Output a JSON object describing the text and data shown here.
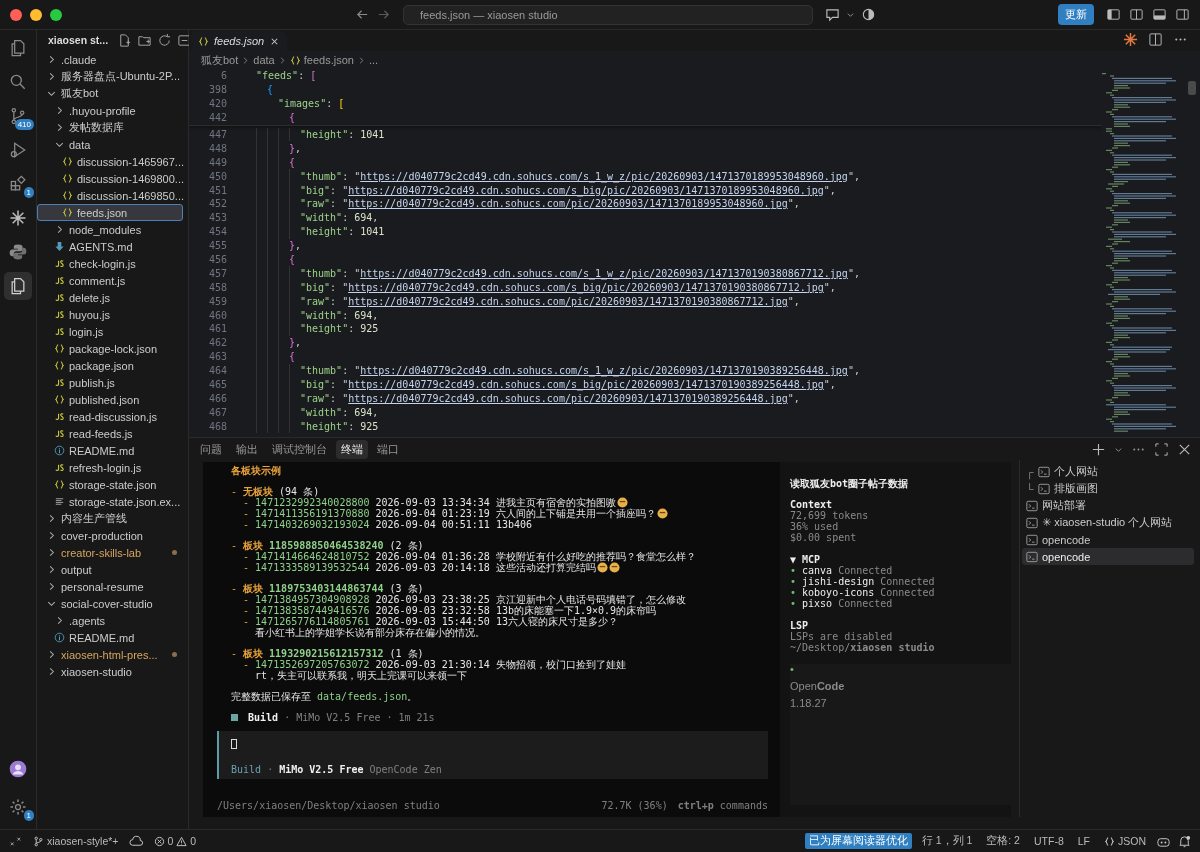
{
  "title_bar": {
    "title": "feeds.json — xiaosen studio",
    "update_button": "更新"
  },
  "activity_bar": {
    "items": [
      {
        "kind": "files",
        "selected": false
      },
      {
        "kind": "search",
        "selected": false
      },
      {
        "kind": "source-control",
        "selected": false,
        "badge": "410"
      },
      {
        "kind": "run",
        "selected": false
      },
      {
        "kind": "extensions",
        "selected": false,
        "badge": "1"
      },
      {
        "kind": "sparkle",
        "selected": false
      },
      {
        "kind": "python",
        "selected": false
      },
      {
        "kind": "docs",
        "selected": true
      }
    ],
    "settings_badge": "1"
  },
  "explorer": {
    "title": "xiaosen st...",
    "tree": [
      {
        "kind": "folder",
        "name": ".claude",
        "expanded": false,
        "selected": false,
        "modified": false
      },
      {
        "kind": "folder",
        "name": "服务器盘点-Ubuntu-2P...",
        "expanded": false,
        "selected": false,
        "modified": false
      },
      {
        "kind": "folder",
        "name": "狐友bot",
        "expanded": true,
        "selected": false,
        "modified": false,
        "children": [
          {
            "kind": "folder",
            "name": ".huyou-profile",
            "expanded": false,
            "selected": false
          },
          {
            "kind": "folder",
            "name": "发帖数据库",
            "expanded": false,
            "selected": false
          },
          {
            "kind": "folder",
            "name": "data",
            "expanded": true,
            "selected": false,
            "children": [
              {
                "kind": "json",
                "name": "discussion-1465967...",
                "selected": false
              },
              {
                "kind": "json",
                "name": "discussion-1469800...",
                "selected": false
              },
              {
                "kind": "json",
                "name": "discussion-1469850...",
                "selected": false
              },
              {
                "kind": "json",
                "name": "feeds.json",
                "selected": true
              }
            ]
          },
          {
            "kind": "folder",
            "name": "node_modules",
            "expanded": false,
            "selected": false
          },
          {
            "kind": "md",
            "name": "AGENTS.md",
            "selected": false
          },
          {
            "kind": "js",
            "name": "check-login.js",
            "selected": false
          },
          {
            "kind": "js",
            "name": "comment.js",
            "selected": false
          },
          {
            "kind": "js",
            "name": "delete.js",
            "selected": false
          },
          {
            "kind": "js",
            "name": "huyou.js",
            "selected": false
          },
          {
            "kind": "js",
            "name": "login.js",
            "selected": false
          },
          {
            "kind": "json",
            "name": "package-lock.json",
            "selected": false
          },
          {
            "kind": "json",
            "name": "package.json",
            "selected": false
          },
          {
            "kind": "js",
            "name": "publish.js",
            "selected": false
          },
          {
            "kind": "json",
            "name": "published.json",
            "selected": false
          },
          {
            "kind": "js",
            "name": "read-discussion.js",
            "selected": false
          },
          {
            "kind": "js",
            "name": "read-feeds.js",
            "selected": false
          },
          {
            "kind": "info",
            "name": "README.md",
            "selected": false
          },
          {
            "kind": "js",
            "name": "refresh-login.js",
            "selected": false
          },
          {
            "kind": "json",
            "name": "storage-state.json",
            "selected": false
          },
          {
            "kind": "text",
            "name": "storage-state.json.ex...",
            "selected": false
          }
        ]
      },
      {
        "kind": "folder",
        "name": "内容生产管线",
        "expanded": false,
        "selected": false,
        "modified": false
      },
      {
        "kind": "folder",
        "name": "cover-production",
        "expanded": false,
        "selected": false,
        "modified": false
      },
      {
        "kind": "folder",
        "name": "creator-skills-lab",
        "expanded": false,
        "selected": false,
        "modified": true
      },
      {
        "kind": "folder",
        "name": "output",
        "expanded": false,
        "selected": false,
        "modified": false
      },
      {
        "kind": "folder",
        "name": "personal-resume",
        "expanded": false,
        "selected": false,
        "modified": false
      },
      {
        "kind": "folder",
        "name": "social-cover-studio",
        "expanded": true,
        "selected": false,
        "modified": false,
        "children": [
          {
            "kind": "folder",
            "name": ".agents",
            "expanded": false,
            "selected": false
          },
          {
            "kind": "info",
            "name": "README.md",
            "selected": false
          }
        ]
      },
      {
        "kind": "folder",
        "name": "xiaosen-html-pres...",
        "expanded": false,
        "selected": false,
        "modified": true
      },
      {
        "kind": "folder",
        "name": "xiaosen-studio",
        "expanded": false,
        "selected": false,
        "modified": false
      }
    ]
  },
  "tabs": [
    {
      "label": "feeds.json",
      "selected": true
    }
  ],
  "breadcrumb": [
    {
      "kind": "folder",
      "text": "狐友bot"
    },
    {
      "kind": "folder",
      "text": "data"
    },
    {
      "kind": "json",
      "text": "feeds.json"
    },
    {
      "kind": "more",
      "text": "..."
    }
  ],
  "editor": {
    "sticky": [
      {
        "number": "6",
        "tokens": [
          {
            "kind": "key",
            "text": "\"feeds\""
          },
          {
            "kind": "punct",
            "text": ": "
          },
          {
            "kind": "open",
            "text": "["
          }
        ]
      },
      {
        "number": "398",
        "tokens": [
          {
            "kind": "open",
            "text": "{"
          }
        ]
      },
      {
        "number": "420",
        "tokens": [
          {
            "kind": "key",
            "text": "\"images\""
          },
          {
            "kind": "punct",
            "text": ": "
          },
          {
            "kind": "open",
            "text": "["
          }
        ]
      },
      {
        "number": "442",
        "tokens": [
          {
            "kind": "open",
            "text": "{"
          }
        ]
      }
    ],
    "lines": [
      {
        "number": "447",
        "tokens": [
          {
            "kind": "key",
            "text": "\"height\""
          },
          {
            "kind": "punct",
            "text": ": "
          },
          {
            "kind": "num",
            "text": "1041"
          }
        ]
      },
      {
        "number": "448",
        "tokens": [
          {
            "kind": "close",
            "text": "}"
          },
          {
            "kind": "punct",
            "text": ","
          }
        ]
      },
      {
        "number": "449",
        "tokens": [
          {
            "kind": "open",
            "text": "{"
          }
        ]
      },
      {
        "number": "450",
        "tokens": [
          {
            "kind": "key",
            "text": "\"thumb\""
          },
          {
            "kind": "punct",
            "text": ": \""
          },
          {
            "kind": "url",
            "text": "https://d040779c2cd49.cdn.sohucs.com/s_1_w_z/pic/20260903/1471370189953048960.jpg"
          },
          {
            "kind": "punct",
            "text": "\","
          }
        ]
      },
      {
        "number": "451",
        "tokens": [
          {
            "kind": "key",
            "text": "\"big\""
          },
          {
            "kind": "punct",
            "text": ": \""
          },
          {
            "kind": "url",
            "text": "https://d040779c2cd49.cdn.sohucs.com/s_big/pic/20260903/1471370189953048960.jpg"
          },
          {
            "kind": "punct",
            "text": "\","
          }
        ]
      },
      {
        "number": "452",
        "tokens": [
          {
            "kind": "key",
            "text": "\"raw\""
          },
          {
            "kind": "punct",
            "text": ": \""
          },
          {
            "kind": "url",
            "text": "https://d040779c2cd49.cdn.sohucs.com/pic/20260903/1471370189953048960.jpg"
          },
          {
            "kind": "punct",
            "text": "\","
          }
        ]
      },
      {
        "number": "453",
        "tokens": [
          {
            "kind": "key",
            "text": "\"width\""
          },
          {
            "kind": "punct",
            "text": ": "
          },
          {
            "kind": "num",
            "text": "694"
          },
          {
            "kind": "punct",
            "text": ","
          }
        ]
      },
      {
        "number": "454",
        "tokens": [
          {
            "kind": "key",
            "text": "\"height\""
          },
          {
            "kind": "punct",
            "text": ": "
          },
          {
            "kind": "num",
            "text": "1041"
          }
        ]
      },
      {
        "number": "455",
        "tokens": [
          {
            "kind": "close",
            "text": "}"
          },
          {
            "kind": "punct",
            "text": ","
          }
        ]
      },
      {
        "number": "456",
        "tokens": [
          {
            "kind": "open",
            "text": "{"
          }
        ]
      },
      {
        "number": "457",
        "tokens": [
          {
            "kind": "key",
            "text": "\"thumb\""
          },
          {
            "kind": "punct",
            "text": ": \""
          },
          {
            "kind": "url",
            "text": "https://d040779c2cd49.cdn.sohucs.com/s_1_w_z/pic/20260903/1471370190380867712.jpg"
          },
          {
            "kind": "punct",
            "text": "\","
          }
        ]
      },
      {
        "number": "458",
        "tokens": [
          {
            "kind": "key",
            "text": "\"big\""
          },
          {
            "kind": "punct",
            "text": ": \""
          },
          {
            "kind": "url",
            "text": "https://d040779c2cd49.cdn.sohucs.com/s_big/pic/20260903/1471370190380867712.jpg"
          },
          {
            "kind": "punct",
            "text": "\","
          }
        ]
      },
      {
        "number": "459",
        "tokens": [
          {
            "kind": "key",
            "text": "\"raw\""
          },
          {
            "kind": "punct",
            "text": ": \""
          },
          {
            "kind": "url",
            "text": "https://d040779c2cd49.cdn.sohucs.com/pic/20260903/1471370190380867712.jpg"
          },
          {
            "kind": "punct",
            "text": "\","
          }
        ]
      },
      {
        "number": "460",
        "tokens": [
          {
            "kind": "key",
            "text": "\"width\""
          },
          {
            "kind": "punct",
            "text": ": "
          },
          {
            "kind": "num",
            "text": "694"
          },
          {
            "kind": "punct",
            "text": ","
          }
        ]
      },
      {
        "number": "461",
        "tokens": [
          {
            "kind": "key",
            "text": "\"height\""
          },
          {
            "kind": "punct",
            "text": ": "
          },
          {
            "kind": "num",
            "text": "925"
          }
        ]
      },
      {
        "number": "462",
        "tokens": [
          {
            "kind": "close",
            "text": "}"
          },
          {
            "kind": "punct",
            "text": ","
          }
        ]
      },
      {
        "number": "463",
        "tokens": [
          {
            "kind": "open",
            "text": "{"
          }
        ]
      },
      {
        "number": "464",
        "tokens": [
          {
            "kind": "key",
            "text": "\"thumb\""
          },
          {
            "kind": "punct",
            "text": ": \""
          },
          {
            "kind": "url",
            "text": "https://d040779c2cd49.cdn.sohucs.com/s_1_w_z/pic/20260903/1471370190389256448.jpg"
          },
          {
            "kind": "punct",
            "text": "\","
          }
        ]
      },
      {
        "number": "465",
        "tokens": [
          {
            "kind": "key",
            "text": "\"big\""
          },
          {
            "kind": "punct",
            "text": ": \""
          },
          {
            "kind": "url",
            "text": "https://d040779c2cd49.cdn.sohucs.com/s_big/pic/20260903/1471370190389256448.jpg"
          },
          {
            "kind": "punct",
            "text": "\","
          }
        ]
      },
      {
        "number": "466",
        "tokens": [
          {
            "kind": "key",
            "text": "\"raw\""
          },
          {
            "kind": "punct",
            "text": ": \""
          },
          {
            "kind": "url",
            "text": "https://d040779c2cd49.cdn.sohucs.com/pic/20260903/1471370190389256448.jpg"
          },
          {
            "kind": "punct",
            "text": "\","
          }
        ]
      },
      {
        "number": "467",
        "tokens": [
          {
            "kind": "key",
            "text": "\"width\""
          },
          {
            "kind": "punct",
            "text": ": "
          },
          {
            "kind": "num",
            "text": "694"
          },
          {
            "kind": "punct",
            "text": ","
          }
        ]
      },
      {
        "number": "468",
        "tokens": [
          {
            "kind": "key",
            "text": "\"height\""
          },
          {
            "kind": "punct",
            "text": ": "
          },
          {
            "kind": "num",
            "text": "925"
          }
        ]
      }
    ]
  },
  "panel": {
    "tabs": [
      {
        "label": "问题",
        "selected": false
      },
      {
        "label": "输出",
        "selected": false
      },
      {
        "label": "调试控制台",
        "selected": false
      },
      {
        "label": "终端",
        "selected": true
      },
      {
        "label": "端口",
        "selected": false
      }
    ]
  },
  "terminal": {
    "blocks": [
      [
        [
          {
            "kind": "heading",
            "text": "各板块示例"
          }
        ]
      ],
      [
        [
          {
            "kind": "dash",
            "text": "- "
          },
          {
            "kind": "section",
            "text": "无板块"
          },
          {
            "kind": "text",
            "text": " (94 条)"
          }
        ],
        [
          {
            "kind": "dash",
            "text": "  - "
          },
          {
            "kind": "id",
            "text": "1471232992340028800"
          },
          {
            "kind": "text",
            "text": " 2026-09-03 13:34:34 进我主页有宿舍的实拍图嗷"
          },
          {
            "kind": "emoji"
          }
        ],
        [
          {
            "kind": "dash",
            "text": "  - "
          },
          {
            "kind": "id",
            "text": "1471411356191370880"
          },
          {
            "kind": "text",
            "text": " 2026-09-04 01:23:19 六人间的上下铺是共用一个插座吗？"
          },
          {
            "kind": "emoji"
          }
        ],
        [
          {
            "kind": "dash",
            "text": "  - "
          },
          {
            "kind": "id",
            "text": "1471403269032193024"
          },
          {
            "kind": "text",
            "text": " 2026-09-04 00:51:11 13b406"
          }
        ]
      ],
      [
        [
          {
            "kind": "dash",
            "text": "- "
          },
          {
            "kind": "section",
            "text": "板块 "
          },
          {
            "kind": "sid",
            "text": "1185988850464538240"
          },
          {
            "kind": "text",
            "text": " (2 条)"
          }
        ],
        [
          {
            "kind": "dash",
            "text": "  - "
          },
          {
            "kind": "id",
            "text": "1471414664624810752"
          },
          {
            "kind": "text",
            "text": " 2026-09-04 01:36:28 学校附近有什么好吃的推荐吗？食堂怎么样？"
          }
        ],
        [
          {
            "kind": "dash",
            "text": "  - "
          },
          {
            "kind": "id",
            "text": "1471333589139532544"
          },
          {
            "kind": "text",
            "text": " 2026-09-03 20:14:18 这些活动还打算完结吗"
          },
          {
            "kind": "emoji"
          },
          {
            "kind": "emoji"
          }
        ]
      ],
      [
        [
          {
            "kind": "dash",
            "text": "- "
          },
          {
            "kind": "section",
            "text": "板块 "
          },
          {
            "kind": "sid",
            "text": "1189753403144863744"
          },
          {
            "kind": "text",
            "text": " (3 条)"
          }
        ],
        [
          {
            "kind": "dash",
            "text": "  - "
          },
          {
            "kind": "id",
            "text": "1471384957304908928"
          },
          {
            "kind": "text",
            "text": " 2026-09-03 23:38:25 京江迎新中个人电话号码填错了，怎么修改"
          }
        ],
        [
          {
            "kind": "dash",
            "text": "  - "
          },
          {
            "kind": "id",
            "text": "1471383587449416576"
          },
          {
            "kind": "text",
            "text": " 2026-09-03 23:32:58 13b的床能塞一下1.9×0.9的床帘吗"
          }
        ],
        [
          {
            "kind": "dash",
            "text": "  - "
          },
          {
            "kind": "id",
            "text": "1471265776114805761"
          },
          {
            "kind": "text",
            "text": " 2026-09-03 15:44:50 13六人寝的床尺寸是多少？"
          }
        ],
        [
          {
            "kind": "text",
            "text": "    看小红书上的学姐学长说有部分床存在偏小的情况。"
          }
        ]
      ],
      [
        [
          {
            "kind": "dash",
            "text": "- "
          },
          {
            "kind": "section",
            "text": "板块 "
          },
          {
            "kind": "sid",
            "text": "1193290215612157312"
          },
          {
            "kind": "text",
            "text": " (1 条)"
          }
        ],
        [
          {
            "kind": "dash",
            "text": "  - "
          },
          {
            "kind": "id",
            "text": "1471352697205763072"
          },
          {
            "kind": "text",
            "text": " 2026-09-03 21:30:14 失物招领，校门口捡到了娃娃"
          }
        ],
        [
          {
            "kind": "text",
            "text": "    rt，失主可以联系我，明天上完课可以来领一下"
          }
        ]
      ],
      [
        [
          {
            "kind": "text",
            "text": "完整数据已保存至 "
          },
          {
            "kind": "path",
            "text": "data/feeds.json"
          },
          {
            "kind": "text",
            "text": "。"
          }
        ]
      ],
      [
        [
          {
            "kind": "square"
          },
          {
            "kind": "bold",
            "text": "Build"
          },
          {
            "kind": "dim",
            "text": " · MiMo V2.5 Free · 1m 21s"
          }
        ]
      ]
    ],
    "prompt": [
      {
        "kind": "accent",
        "text": "Build"
      },
      {
        "kind": "dim",
        "text": " · "
      },
      {
        "kind": "bold",
        "text": "MiMo V2.5 Free"
      },
      {
        "kind": "dim",
        "text": " OpenCode Zen"
      }
    ],
    "footer": {
      "path": "/Users/xiaosen/Desktop/xiaosen studio",
      "usage": "72.7K (36%)",
      "commands": "**ctrl+p** commands"
    },
    "session": {
      "title": "读取狐友bot圈子帖子数据",
      "context_label": "Context",
      "context": [
        "72,699 tokens",
        "36% used",
        "$0.00 spent"
      ],
      "mcp_label": "▼ MCP",
      "mcp": [
        {
          "bullet": "•",
          "name": "canva",
          "status": "Connected"
        },
        {
          "bullet": "•",
          "name": "jishi-design",
          "status": "Connected"
        },
        {
          "bullet": "•",
          "name": "koboyo-icons",
          "status": "Connected"
        },
        {
          "bullet": "•",
          "name": "pixso",
          "status": "Connected"
        }
      ],
      "lsp_label": "LSP",
      "lsp_status": "LSPs are disabled",
      "cwd": "~/Desktop/**xiaosen studio**",
      "app_bullet": "•",
      "app": "Open**Code**",
      "version": "1.18.27"
    }
  },
  "terminal_list": [
    {
      "prefix": "┌",
      "label": "个人网站",
      "selected": false
    },
    {
      "prefix": "└",
      "label": "排版画图",
      "selected": false
    },
    {
      "label": "网站部署",
      "selected": false
    },
    {
      "label": "✳ xiaosen-studio 个人网站",
      "selected": false
    },
    {
      "label": "opencode",
      "selected": false
    },
    {
      "label": "opencode",
      "selected": true
    }
  ],
  "status_bar": {
    "branch": "xiaosen-style*+",
    "errors": "0",
    "warnings": "0",
    "screen_reader": "已为屏幕阅读器优化",
    "position": "行 1，列 1",
    "indent": "空格: 2",
    "encoding": "UTF-8",
    "eol": "LF",
    "language": "JSON"
  }
}
